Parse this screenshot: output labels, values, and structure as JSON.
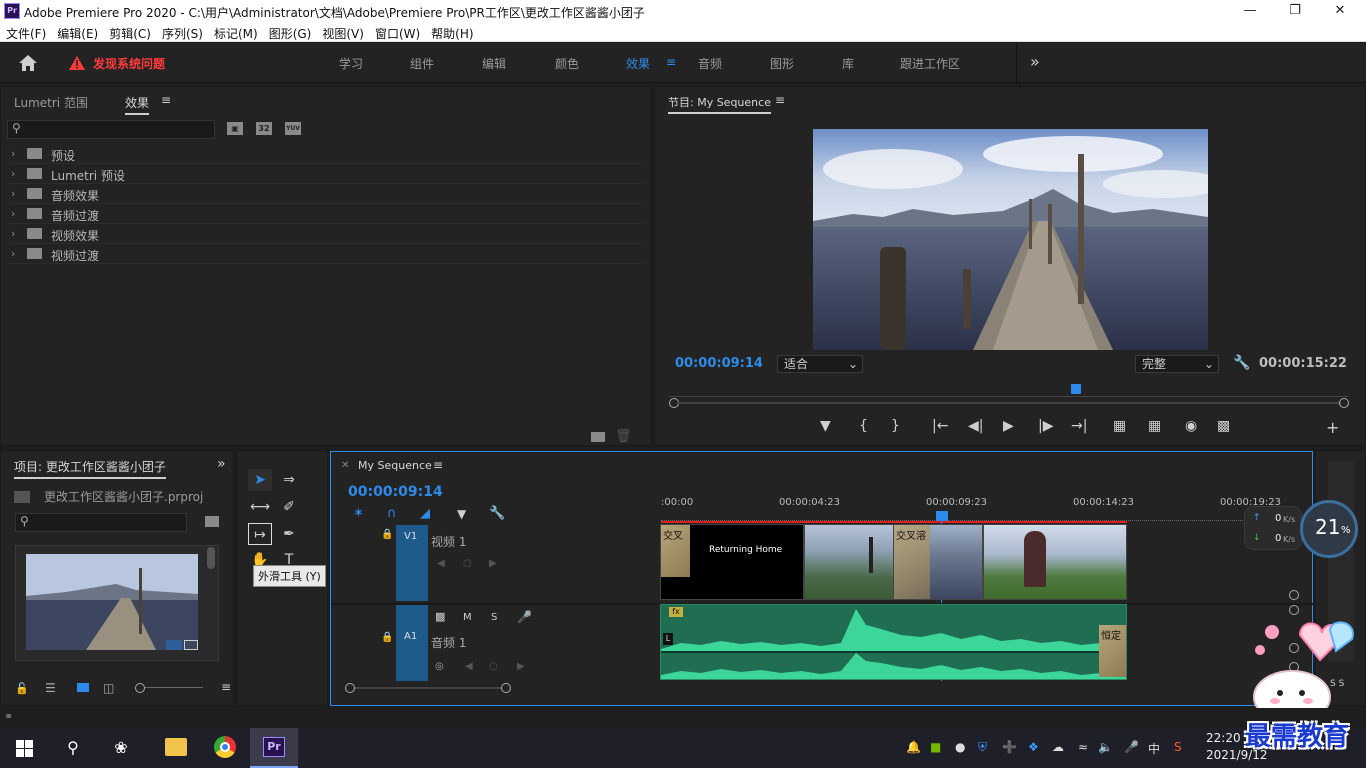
{
  "window": {
    "title": "Adobe Premiere Pro 2020 - C:\\用户\\Administrator\\文档\\Adobe\\Premiere Pro\\PR工作区\\更改工作区酱酱小团子",
    "logo": "Pr"
  },
  "menu": [
    "文件(F)",
    "编辑(E)",
    "剪辑(C)",
    "序列(S)",
    "标记(M)",
    "图形(G)",
    "视图(V)",
    "窗口(W)",
    "帮助(H)"
  ],
  "workspace": {
    "warning": "发现系统问题",
    "tabs": [
      "学习",
      "组件",
      "编辑",
      "颜色",
      "效果",
      "音频",
      "图形",
      "库",
      "跟进工作区"
    ],
    "active_tab": "效果",
    "more": "»"
  },
  "effects_panel": {
    "tabs": [
      "Lumetri 范围",
      "效果"
    ],
    "badges": [
      "32",
      "YUV"
    ],
    "items": [
      "预设",
      "Lumetri 预设",
      "音频效果",
      "音频过渡",
      "视频效果",
      "视频过渡"
    ]
  },
  "program_monitor": {
    "title": "节目: My Sequence",
    "timecode": "00:00:09:14",
    "fit": "适合",
    "quality": "完整",
    "duration": "00:00:15:22"
  },
  "project_panel": {
    "title": "项目: 更改工作区酱酱小团子",
    "file": "更改工作区酱酱小团子.prproj"
  },
  "tools": {
    "tooltip": "外滑工具 (Y)"
  },
  "timeline": {
    "tab": "My Sequence",
    "timecode": "00:00:09:14",
    "ruler": [
      ":00:00",
      "00:00:04:23",
      "00:00:09:23",
      "00:00:14:23",
      "00:00:19:23"
    ],
    "v1": {
      "label": "V1",
      "name": "视频 1"
    },
    "a1": {
      "label": "A1",
      "name": "音频 1",
      "m": "M",
      "s": "S"
    },
    "clip_title": "Returning Home",
    "transition_label": "交叉",
    "transition_label2": "交叉溶",
    "audio_transition": "恒定",
    "fx": "fx",
    "l": "L"
  },
  "overlay": {
    "up_speed": "0",
    "down_speed": "0",
    "unit": "K/s",
    "percent": "21",
    "percent_sign": "%",
    "watermark": "最需教育",
    "ss": "S S"
  },
  "taskbar": {
    "time": "22:20",
    "date": "2021/9/12",
    "ime": "中"
  },
  "colors": {
    "accent": "#2d8ceb",
    "warning": "#ff3b3b",
    "audio": "#28b07a",
    "track_blue": "#1f5a8c"
  }
}
